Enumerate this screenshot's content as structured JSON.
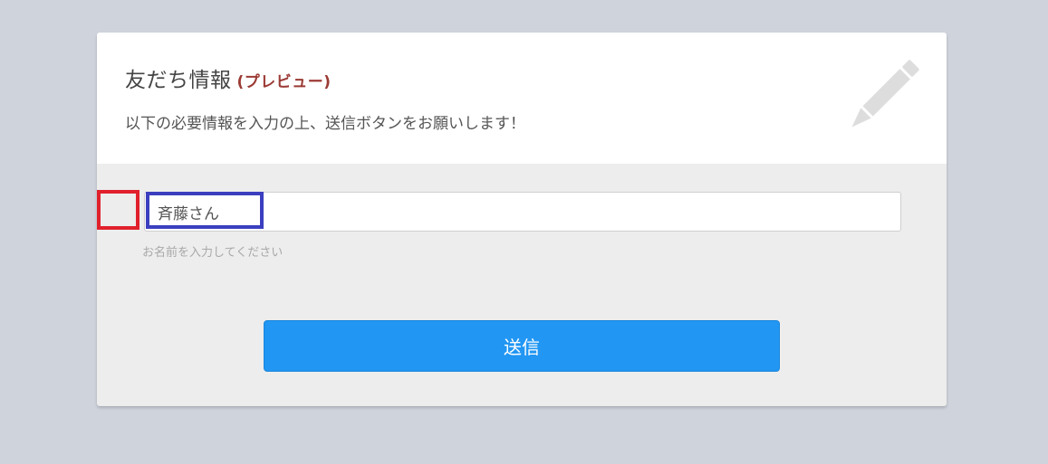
{
  "header": {
    "title": "友だち情報",
    "preview_tag": "(プレビュー)",
    "subtitle": "以下の必要情報を入力の上、送信ボタンをお願いします！",
    "icon": "pencil-icon"
  },
  "form": {
    "name_field": {
      "value": "斉藤さん",
      "hint": "お名前を入力してください"
    },
    "submit_label": "送信"
  },
  "colors": {
    "page_background": "#cfd3dc",
    "form_background": "#ededed",
    "accent_button": "#2196f3",
    "preview_tag": "#9b3a34",
    "highlight_red": "#e0212c",
    "highlight_blue": "#3b3fbf"
  }
}
